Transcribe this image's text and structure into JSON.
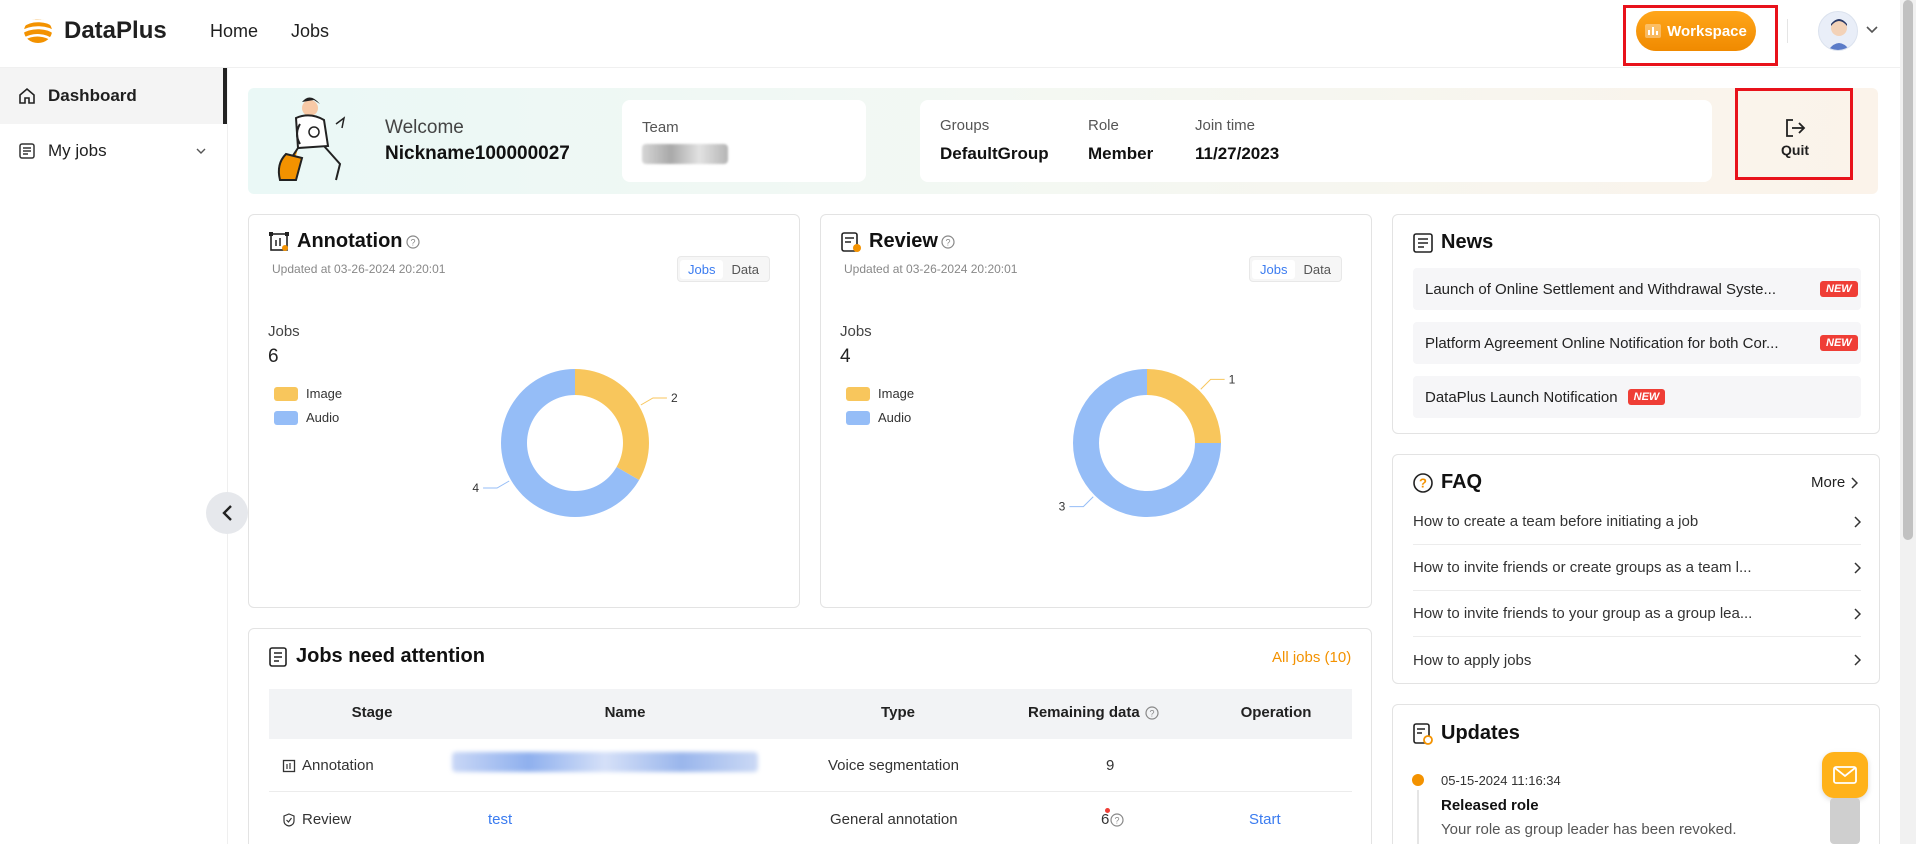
{
  "header": {
    "brand": "DataPlus",
    "nav": [
      "Home",
      "Jobs"
    ],
    "workspace_label": "Workspace"
  },
  "sidebar": {
    "items": [
      {
        "label": "Dashboard",
        "icon": "home-icon"
      },
      {
        "label": "My jobs",
        "icon": "clipboard-icon"
      }
    ]
  },
  "welcome": {
    "greeting": "Welcome",
    "nickname": "Nickname100000027",
    "team_label": "Team",
    "groups_label": "Groups",
    "groups_value": "DefaultGroup",
    "role_label": "Role",
    "role_value": "Member",
    "join_label": "Join time",
    "join_value": "11/27/2023",
    "quit_label": "Quit"
  },
  "annotation": {
    "title": "Annotation",
    "updated": "Updated at 03-26-2024 20:20:01",
    "toggle": [
      "Jobs",
      "Data"
    ],
    "metric_label": "Jobs",
    "metric_value": "6",
    "legend": [
      "Image",
      "Audio"
    ]
  },
  "review": {
    "title": "Review",
    "updated": "Updated at 03-26-2024 20:20:01",
    "toggle": [
      "Jobs",
      "Data"
    ],
    "metric_label": "Jobs",
    "metric_value": "4",
    "legend": [
      "Image",
      "Audio"
    ]
  },
  "chart_data": [
    {
      "type": "pie",
      "title": "Annotation",
      "categories": [
        "Image",
        "Audio"
      ],
      "values": [
        2,
        4
      ],
      "colors": [
        "#f8c65c",
        "#95bdf7"
      ]
    },
    {
      "type": "pie",
      "title": "Review",
      "categories": [
        "Image",
        "Audio"
      ],
      "values": [
        1,
        3
      ],
      "colors": [
        "#f8c65c",
        "#95bdf7"
      ]
    }
  ],
  "news": {
    "title": "News",
    "items": [
      "Launch of Online Settlement and Withdrawal Syste...",
      "Platform Agreement Online Notification for both Cor...",
      "DataPlus Launch Notification"
    ],
    "badge": "NEW"
  },
  "faq": {
    "title": "FAQ",
    "more": "More",
    "items": [
      "How to create a team before initiating a job",
      "How to invite friends or create groups as a team l...",
      "How to invite friends to your group as a group lea...",
      "How to apply jobs"
    ]
  },
  "updates": {
    "title": "Updates",
    "date": "05-15-2024 11:16:34",
    "heading": "Released role",
    "text": "Your role as group leader has been revoked."
  },
  "attention": {
    "title": "Jobs need attention",
    "all_jobs": "All jobs (10)",
    "columns": [
      "Stage",
      "Name",
      "Type",
      "Remaining data",
      "Operation"
    ],
    "rows": [
      {
        "stage": "Annotation",
        "name": "",
        "type": "Voice segmentation",
        "remaining": "9",
        "operation": ""
      },
      {
        "stage": "Review",
        "name": "test",
        "type": "General annotation",
        "remaining": "6",
        "operation": "Start"
      }
    ]
  },
  "colors": {
    "accent": "#f39200",
    "link": "#3b7cf0",
    "image": "#f8c65c",
    "audio": "#95bdf7",
    "badge": "#ef3e36"
  }
}
